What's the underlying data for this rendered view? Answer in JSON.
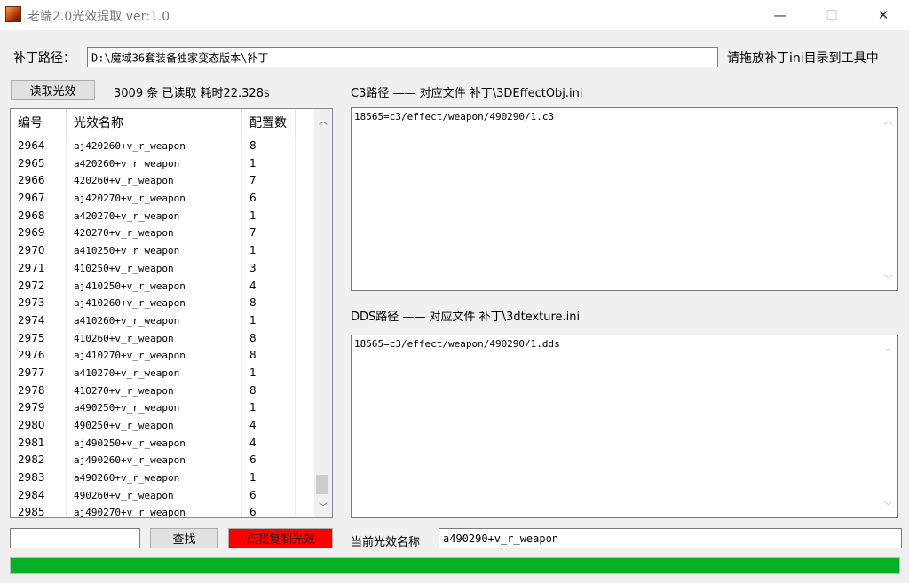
{
  "window": {
    "title": "老端2.0光效提取 ver:1.0",
    "minimize_glyph": "—",
    "maximize_glyph": "☐",
    "close_glyph": "✕"
  },
  "patch": {
    "label": "补丁路径：",
    "path_value": "D:\\魔域36套装备独家变态版本\\补丁",
    "hint": "请拖放补丁ini目录到工具中"
  },
  "read": {
    "button_label": "读取光效",
    "status": "3009 条 已读取 耗时22.328s"
  },
  "list": {
    "headers": [
      "编号",
      "光效名称",
      "配置数"
    ],
    "rows": [
      [
        "2964",
        "aj420260+v_r_weapon",
        "8"
      ],
      [
        "2965",
        "a420260+v_r_weapon",
        "1"
      ],
      [
        "2966",
        "420260+v_r_weapon",
        "7"
      ],
      [
        "2967",
        "aj420270+v_r_weapon",
        "6"
      ],
      [
        "2968",
        "a420270+v_r_weapon",
        "1"
      ],
      [
        "2969",
        "420270+v_r_weapon",
        "7"
      ],
      [
        "2970",
        "a410250+v_r_weapon",
        "1"
      ],
      [
        "2971",
        "410250+v_r_weapon",
        "3"
      ],
      [
        "2972",
        "aj410250+v_r_weapon",
        "4"
      ],
      [
        "2973",
        "aj410260+v_r_weapon",
        "8"
      ],
      [
        "2974",
        "a410260+v_r_weapon",
        "1"
      ],
      [
        "2975",
        "410260+v_r_weapon",
        "8"
      ],
      [
        "2976",
        "aj410270+v_r_weapon",
        "8"
      ],
      [
        "2977",
        "a410270+v_r_weapon",
        "1"
      ],
      [
        "2978",
        "410270+v_r_weapon",
        "8"
      ],
      [
        "2979",
        "a490250+v_r_weapon",
        "1"
      ],
      [
        "2980",
        "490250+v_r_weapon",
        "4"
      ],
      [
        "2981",
        "aj490250+v_r_weapon",
        "4"
      ],
      [
        "2982",
        "aj490260+v_r_weapon",
        "6"
      ],
      [
        "2983",
        "a490260+v_r_weapon",
        "1"
      ],
      [
        "2984",
        "490260+v_r_weapon",
        "6"
      ],
      [
        "2985",
        "aj490270+v_r_weapon",
        "6"
      ]
    ],
    "scroll_up_glyph": "︿",
    "scroll_down_glyph": "﹀"
  },
  "c3": {
    "label": "C3路径 —— 对应文件 补丁\\3DEffectObj.ini",
    "content": "18565=c3/effect/weapon/490290/1.c3"
  },
  "dds": {
    "label": "DDS路径 —— 对应文件 补丁\\3dtexture.ini",
    "content": "18565=c3/effect/weapon/490290/1.dds"
  },
  "search": {
    "value": "",
    "button_label": "查找"
  },
  "copy_button": {
    "label": "点我复制光效",
    "color": "#ff0000"
  },
  "current_effect": {
    "label": "当前光效名称",
    "value": "a490290+v_r_weapon"
  },
  "progress": {
    "percent": 100,
    "color": "#06b025"
  }
}
